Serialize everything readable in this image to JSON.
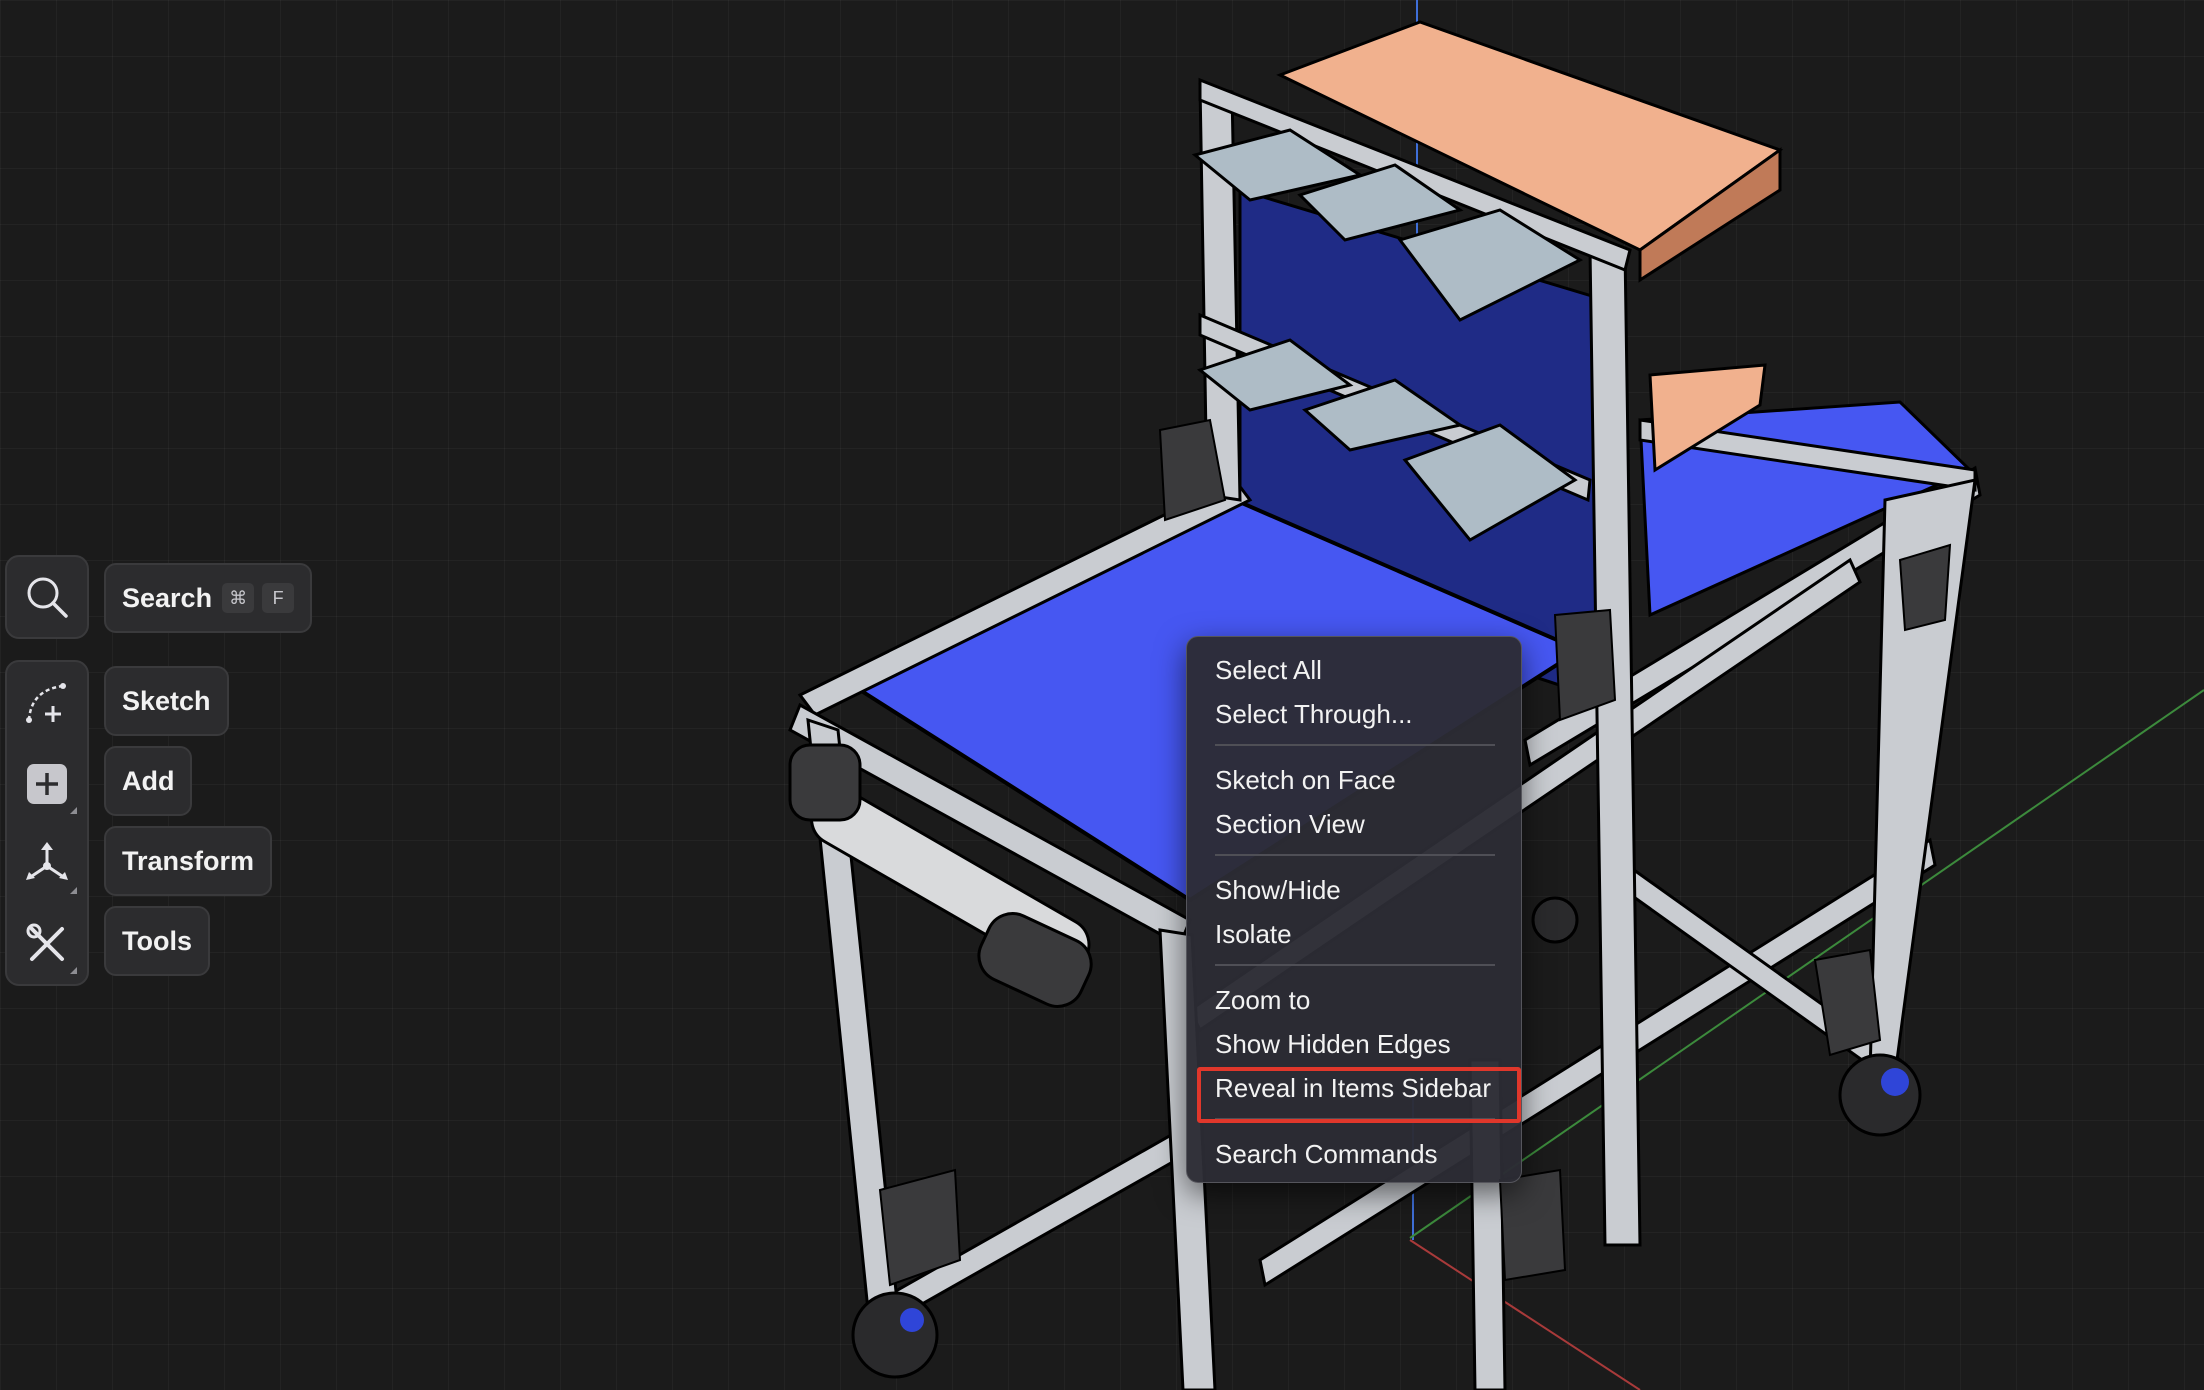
{
  "toolbar": {
    "search": {
      "label": "Search",
      "shortcut_keys": [
        "⌘",
        "F"
      ],
      "icon": "magnifier-icon"
    },
    "tools": [
      {
        "label": "Sketch",
        "icon": "sketch-curve-icon"
      },
      {
        "label": "Add",
        "icon": "plus-square-icon"
      },
      {
        "label": "Transform",
        "icon": "transform-axes-icon"
      },
      {
        "label": "Tools",
        "icon": "wrench-screwdriver-icon"
      }
    ]
  },
  "context_menu": {
    "groups": [
      [
        "Select All",
        "Select Through..."
      ],
      [
        "Sketch on Face",
        "Section View"
      ],
      [
        "Show/Hide",
        "Isolate"
      ],
      [
        "Zoom to",
        "Show Hidden Edges",
        "Reveal in Items Sidebar"
      ],
      [
        "Search Commands"
      ]
    ],
    "highlighted_item": "Reveal in Items Sidebar",
    "highlight_color": "#e0372b"
  },
  "colors": {
    "background": "#1b1b1b",
    "worktop_blue": "#4657f2",
    "back_panel_navy": "#1f2b86",
    "shelf_peach": "#f1b18e",
    "frame_aluminum": "#c9ccd1",
    "bin_gray": "#aebcc6"
  }
}
